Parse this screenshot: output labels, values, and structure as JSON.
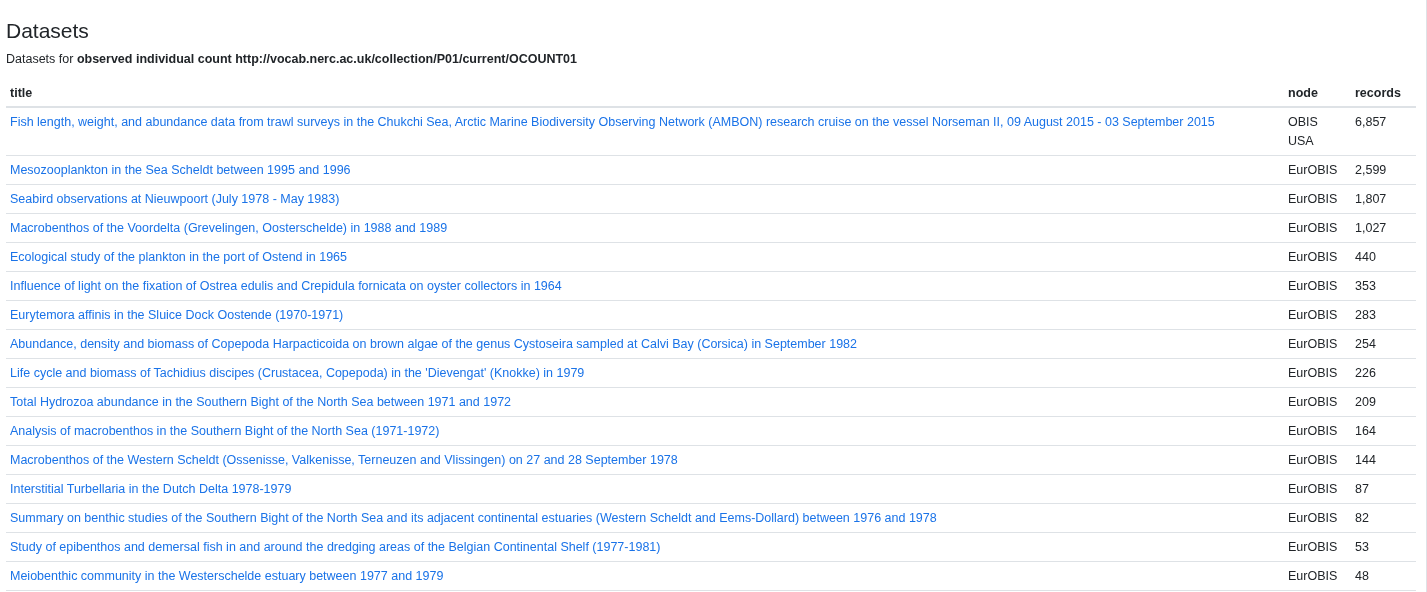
{
  "heading": "Datasets",
  "description": "Datasets for **observed individual count http://vocab.nerc.ac.uk/collection/P01/current/OCOUNT01**",
  "table": {
    "columns": [
      "title",
      "node",
      "records"
    ],
    "rows": [
      {
        "title": "Fish length, weight, and abundance data from trawl surveys in the Chukchi Sea, Arctic Marine Biodiversity Observing Network (AMBON) research cruise on the vessel Norseman II, 09 August 2015 - 03 September 2015",
        "node": "OBIS USA",
        "records": "6,857"
      },
      {
        "title": "Mesozooplankton in the Sea Scheldt between 1995 and 1996",
        "node": "EurOBIS",
        "records": "2,599"
      },
      {
        "title": "Seabird observations at Nieuwpoort (July 1978 - May 1983)",
        "node": "EurOBIS",
        "records": "1,807"
      },
      {
        "title": "Macrobenthos of the Voordelta (Grevelingen, Oosterschelde) in 1988 and 1989",
        "node": "EurOBIS",
        "records": "1,027"
      },
      {
        "title": "Ecological study of the plankton in the port of Ostend in 1965",
        "node": "EurOBIS",
        "records": "440"
      },
      {
        "title": "Influence of light on the fixation of Ostrea edulis and Crepidula fornicata on oyster collectors in 1964",
        "node": "EurOBIS",
        "records": "353"
      },
      {
        "title": "Eurytemora affinis in the Sluice Dock Oostende (1970-1971)",
        "node": "EurOBIS",
        "records": "283"
      },
      {
        "title": "Abundance, density and biomass of Copepoda Harpacticoida on brown algae of the genus Cystoseira sampled at Calvi Bay (Corsica) in September 1982",
        "node": "EurOBIS",
        "records": "254"
      },
      {
        "title": "Life cycle and biomass of Tachidius discipes (Crustacea, Copepoda) in the 'Dievengat' (Knokke) in 1979",
        "node": "EurOBIS",
        "records": "226"
      },
      {
        "title": "Total Hydrozoa abundance in the Southern Bight of the North Sea between 1971 and 1972",
        "node": "EurOBIS",
        "records": "209"
      },
      {
        "title": "Analysis of macrobenthos in the Southern Bight of the North Sea (1971-1972)",
        "node": "EurOBIS",
        "records": "164"
      },
      {
        "title": "Macrobenthos of the Western Scheldt (Ossenisse, Valkenisse, Terneuzen and Vlissingen) on 27 and 28 September 1978",
        "node": "EurOBIS",
        "records": "144"
      },
      {
        "title": "Interstitial Turbellaria in the Dutch Delta 1978-1979",
        "node": "EurOBIS",
        "records": "87"
      },
      {
        "title": "Summary on benthic studies of the Southern Bight of the North Sea and its adjacent continental estuaries (Western Scheldt and Eems-Dollard) between 1976 and 1978",
        "node": "EurOBIS",
        "records": "82"
      },
      {
        "title": "Study of epibenthos and demersal fish in and around the dredging areas of the Belgian Continental Shelf (1977-1981)",
        "node": "EurOBIS",
        "records": "53"
      },
      {
        "title": "Meiobenthic community in the Westerschelde estuary between 1977 and 1979",
        "node": "EurOBIS",
        "records": "48"
      }
    ]
  }
}
